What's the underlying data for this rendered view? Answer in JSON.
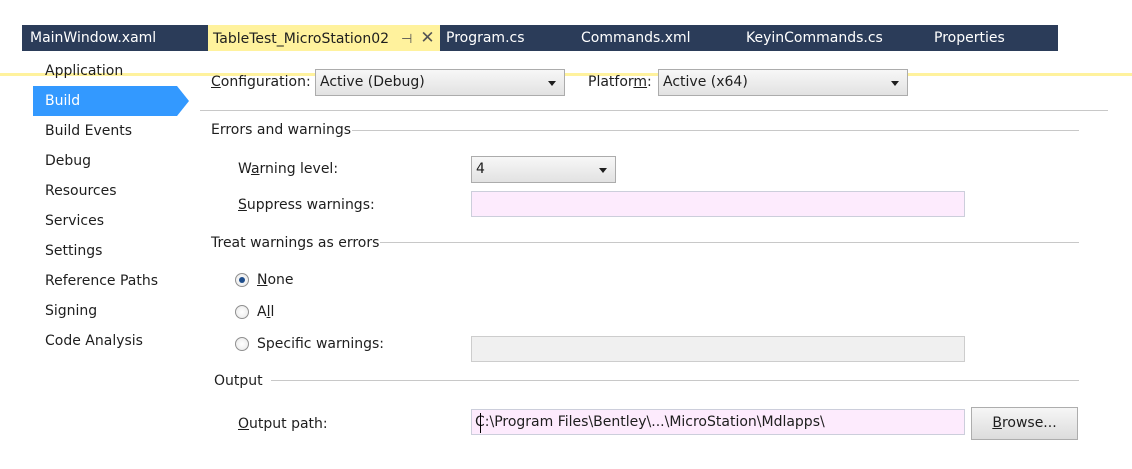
{
  "tabs": [
    {
      "label": "MainWindow.xaml",
      "active": false
    },
    {
      "label": "TableTest_MicroStation02",
      "active": true
    },
    {
      "label": "Program.cs",
      "active": false
    },
    {
      "label": "Commands.xml",
      "active": false
    },
    {
      "label": "KeyinCommands.cs",
      "active": false
    },
    {
      "label": "Properties",
      "active": false
    }
  ],
  "tab_icons": {
    "pin": "pin-icon",
    "close": "close-icon"
  },
  "sidebar": {
    "items": [
      {
        "label": "Application"
      },
      {
        "label": "Build"
      },
      {
        "label": "Build Events"
      },
      {
        "label": "Debug"
      },
      {
        "label": "Resources"
      },
      {
        "label": "Services"
      },
      {
        "label": "Settings"
      },
      {
        "label": "Reference Paths"
      },
      {
        "label": "Signing"
      },
      {
        "label": "Code Analysis"
      }
    ],
    "selected": "Build"
  },
  "config": {
    "configuration_label_pre": "",
    "configuration_label_u": "C",
    "configuration_label_post": "onfiguration:",
    "configuration_value": "Active (Debug)",
    "platform_label_pre": "Platfor",
    "platform_label_u": "m",
    "platform_label_post": ":",
    "platform_value": "Active (x64)"
  },
  "errors_section": {
    "title": "Errors and warnings",
    "warning_level_pre": "W",
    "warning_level_u": "a",
    "warning_level_post": "rning level:",
    "warning_level_value": "4",
    "suppress_pre": "",
    "suppress_u": "S",
    "suppress_post": "uppress warnings:",
    "suppress_value": ""
  },
  "treat_section": {
    "title": "Treat warnings as errors",
    "options": [
      {
        "pre": "",
        "u": "N",
        "post": "one",
        "checked": true
      },
      {
        "pre": "A",
        "u": "l",
        "post": "l",
        "checked": false
      },
      {
        "pre": "Specif",
        "u": "i",
        "post": "c warnings:",
        "checked": false
      }
    ],
    "specific_value": ""
  },
  "output_section": {
    "title": "Output",
    "path_pre": "",
    "path_u": "O",
    "path_post": "utput path:",
    "path_value": "C:\\Program Files\\Bentley\\...\\MicroStation\\Mdlapps\\",
    "browse_pre": "",
    "browse_u": "B",
    "browse_post": "rowse..."
  },
  "colors": {
    "tab_bar": "#2b3c59",
    "active_tab": "#fff29d",
    "selection": "#3399ff",
    "textbox_bg": "#fdebfd"
  }
}
